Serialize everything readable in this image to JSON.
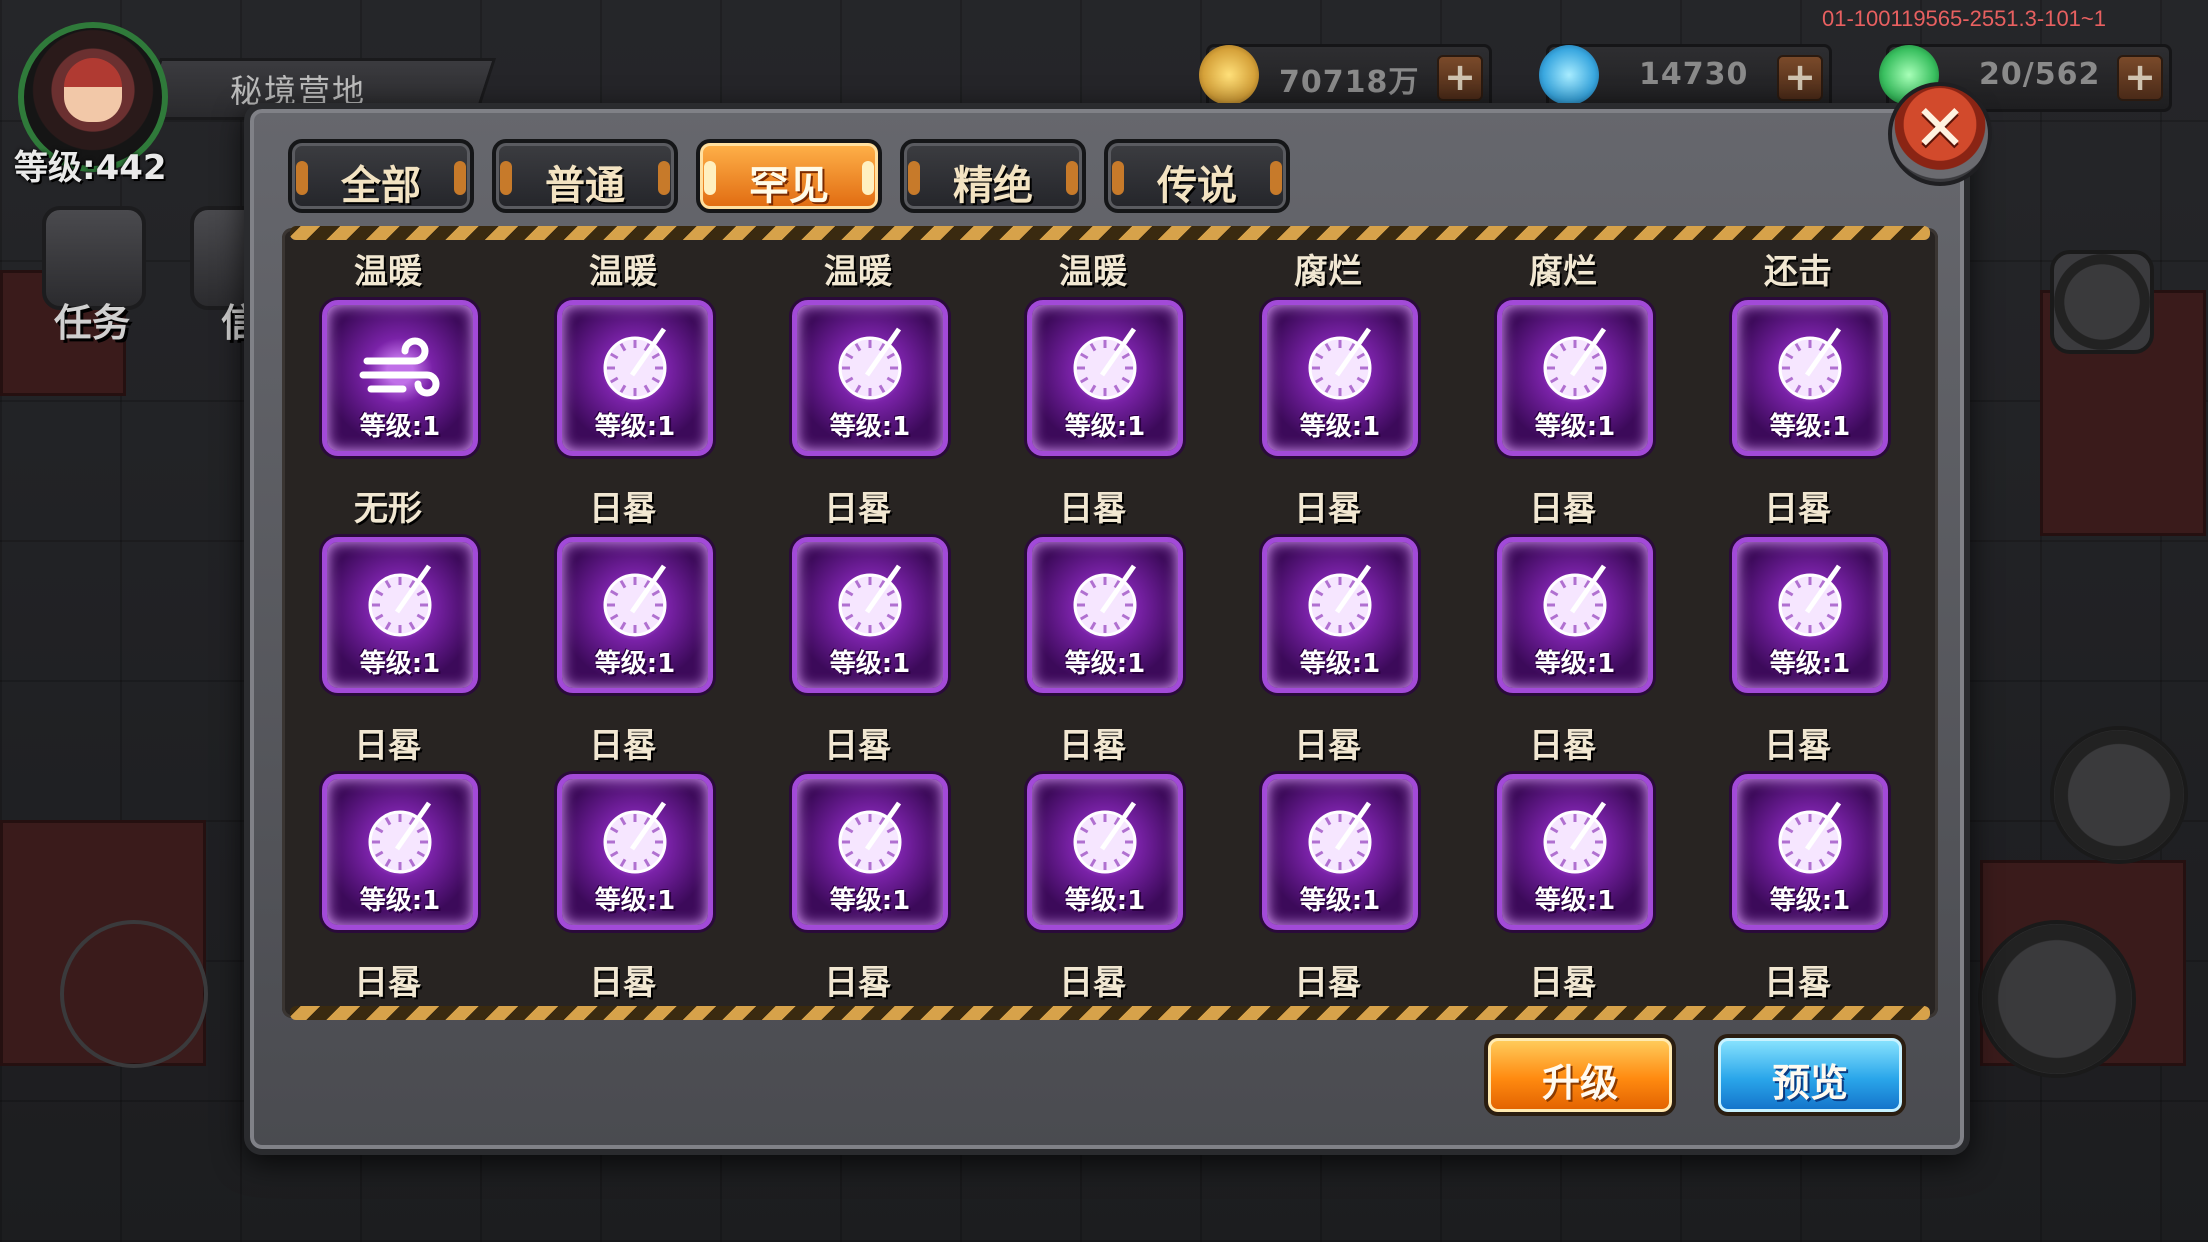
{
  "hud": {
    "map_name": "秘境营地",
    "player_level": "等级:442",
    "side_buttons": [
      {
        "label": "任务"
      },
      {
        "label": "信"
      }
    ],
    "build_id": "01-100119565-2551.3-101~1",
    "resources": [
      {
        "icon": "gold-coin-icon",
        "value": "70718万",
        "color": "#d6a23a"
      },
      {
        "icon": "diamond-icon",
        "value": "14730",
        "color": "#3aa8e0"
      },
      {
        "icon": "energy-icon",
        "value": "20/562",
        "color": "#3ac060"
      }
    ],
    "plus_glyph": "+"
  },
  "dialog": {
    "close_glyph": "✕",
    "tabs": [
      {
        "label": "全部",
        "active": false
      },
      {
        "label": "普通",
        "active": false
      },
      {
        "label": "罕见",
        "active": true
      },
      {
        "label": "精绝",
        "active": false
      },
      {
        "label": "传说",
        "active": false
      }
    ],
    "skills": [
      {
        "name": "温暖",
        "level": "等级:1",
        "icon": "wind-icon"
      },
      {
        "name": "温暖",
        "level": "等级:1",
        "icon": "sundial-icon"
      },
      {
        "name": "温暖",
        "level": "等级:1",
        "icon": "sundial-icon"
      },
      {
        "name": "温暖",
        "level": "等级:1",
        "icon": "sundial-icon"
      },
      {
        "name": "腐烂",
        "level": "等级:1",
        "icon": "sundial-icon"
      },
      {
        "name": "腐烂",
        "level": "等级:1",
        "icon": "sundial-icon"
      },
      {
        "name": "还击",
        "level": "等级:1",
        "icon": "sundial-icon"
      },
      {
        "name": "无形",
        "level": "等级:1",
        "icon": "sundial-icon"
      },
      {
        "name": "日晷",
        "level": "等级:1",
        "icon": "sundial-icon"
      },
      {
        "name": "日晷",
        "level": "等级:1",
        "icon": "sundial-icon"
      },
      {
        "name": "日晷",
        "level": "等级:1",
        "icon": "sundial-icon"
      },
      {
        "name": "日晷",
        "level": "等级:1",
        "icon": "sundial-icon"
      },
      {
        "name": "日晷",
        "level": "等级:1",
        "icon": "sundial-icon"
      },
      {
        "name": "日晷",
        "level": "等级:1",
        "icon": "sundial-icon"
      },
      {
        "name": "日晷",
        "level": "等级:1",
        "icon": "sundial-icon"
      },
      {
        "name": "日晷",
        "level": "等级:1",
        "icon": "sundial-icon"
      },
      {
        "name": "日晷",
        "level": "等级:1",
        "icon": "sundial-icon"
      },
      {
        "name": "日晷",
        "level": "等级:1",
        "icon": "sundial-icon"
      },
      {
        "name": "日晷",
        "level": "等级:1",
        "icon": "sundial-icon"
      },
      {
        "name": "日晷",
        "level": "等级:1",
        "icon": "sundial-icon"
      },
      {
        "name": "日晷",
        "level": "等级:1",
        "icon": "sundial-icon"
      }
    ],
    "trailing_labels": [
      "日晷",
      "日晷",
      "日晷",
      "日晷",
      "日晷",
      "日晷",
      "日晷"
    ],
    "upgrade_label": "升级",
    "preview_label": "预览"
  }
}
